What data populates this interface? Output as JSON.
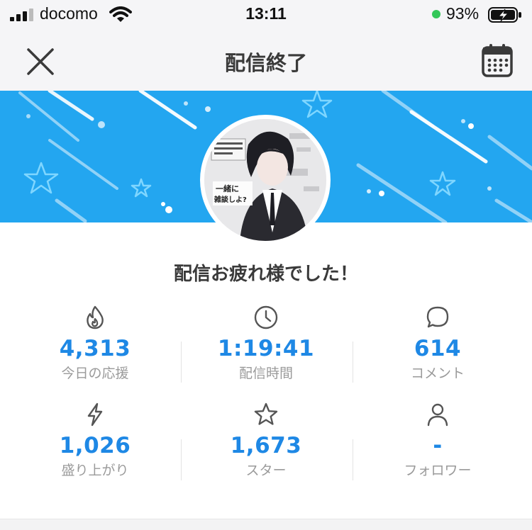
{
  "status_bar": {
    "carrier": "docomo",
    "time": "13:11",
    "battery_percent": "93%",
    "battery_level": 0.93,
    "charging_dot_color": "#34c759"
  },
  "navbar": {
    "title": "配信終了",
    "close_icon": "close-icon",
    "calendar_icon": "calendar-icon"
  },
  "banner": {
    "color": "#23a6f0"
  },
  "avatar": {
    "image_text": [
      "一緒に",
      "雑談しよ?"
    ]
  },
  "message": "配信お疲れ様でした！",
  "stats": [
    {
      "icon": "flame-icon",
      "value": "4,313",
      "label": "今日の応援"
    },
    {
      "icon": "clock-icon",
      "value": "1:19:41",
      "label": "配信時間"
    },
    {
      "icon": "comment-icon",
      "value": "614",
      "label": "コメント"
    },
    {
      "icon": "lightning-icon",
      "value": "1,026",
      "label": "盛り上がり"
    },
    {
      "icon": "star-icon",
      "value": "1,673",
      "label": "スター"
    },
    {
      "icon": "person-icon",
      "value": "-",
      "label": "フォロワー"
    }
  ],
  "colors": {
    "accent": "#1e88e5",
    "label": "#9a9a9a"
  }
}
